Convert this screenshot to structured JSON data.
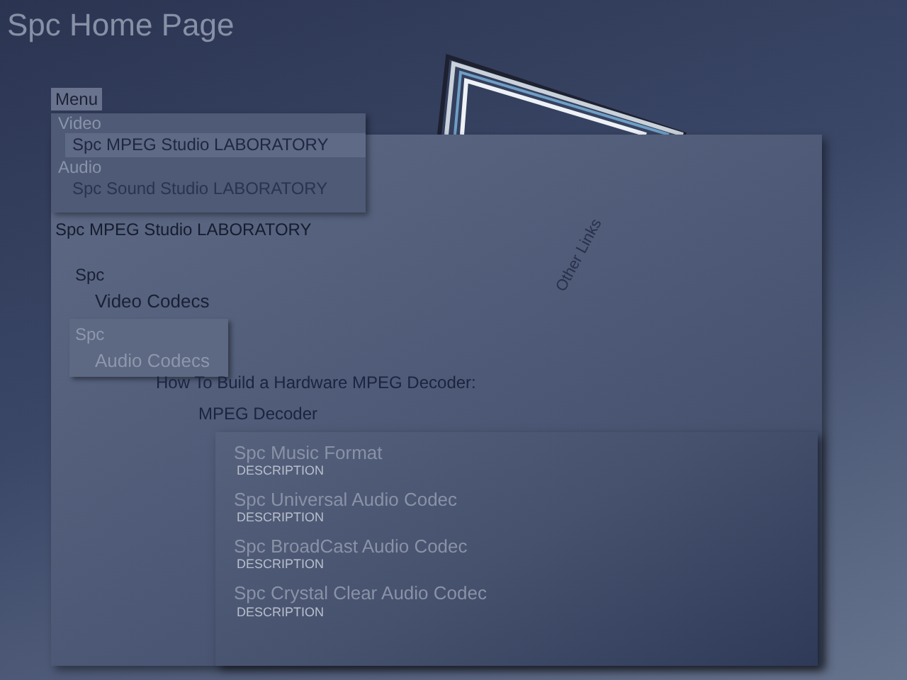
{
  "page_title": "Spc Home Page",
  "menu": {
    "label": "Menu",
    "groups": [
      {
        "label": "Video",
        "items": [
          {
            "label": "Spc MPEG Studio LABORATORY",
            "selected": true
          }
        ]
      },
      {
        "label": "Audio",
        "items": [
          {
            "label": "Spc Sound Studio LABORATORY",
            "selected": false
          }
        ]
      }
    ]
  },
  "side_label": "Other Links",
  "content": {
    "heading": "Spc MPEG Studio LABORATORY",
    "categories": [
      {
        "prefix": "Spc",
        "label": "Video Codecs",
        "selected": true
      },
      {
        "prefix": "Spc",
        "label": "Audio Codecs",
        "selected": false
      }
    ],
    "links": [
      "How To Build a Hardware MPEG Decoder:",
      "MPEG Decoder"
    ]
  },
  "codecs": [
    {
      "name": "Spc Music Format",
      "description": "DESCRIPTION"
    },
    {
      "name": "Spc Universal Audio Codec",
      "description": "DESCRIPTION"
    },
    {
      "name": "Spc BroadCast Audio Codec",
      "description": "DESCRIPTION"
    },
    {
      "name": "Spc Crystal Clear Audio Codec",
      "description": "DESCRIPTION"
    }
  ]
}
